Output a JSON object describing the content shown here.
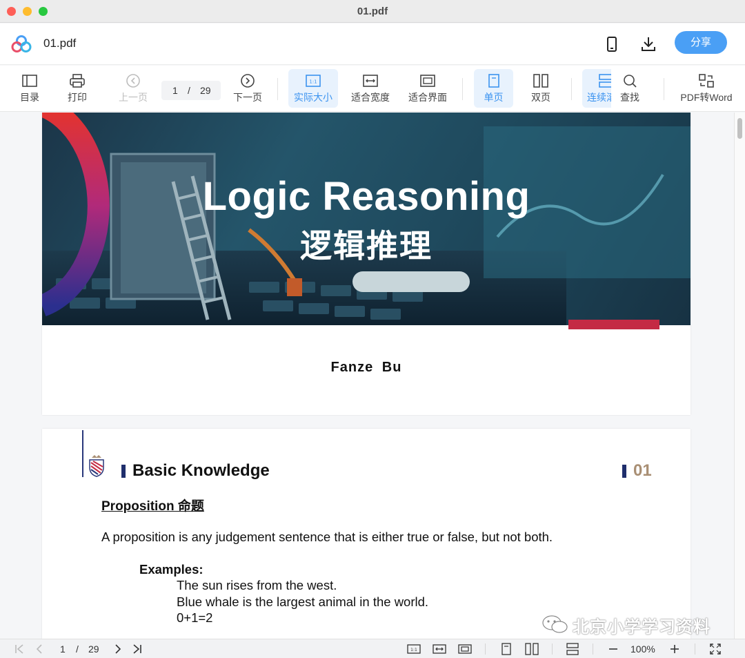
{
  "window": {
    "title": "01.pdf"
  },
  "header": {
    "filename": "01.pdf",
    "share_label": "分享",
    "accent": "#4a9ff5"
  },
  "toolbar": {
    "toc": "目录",
    "print": "打印",
    "prev": "上一页",
    "page_current": "1",
    "page_sep": "/",
    "page_total": "29",
    "next": "下一页",
    "actual_size": "实际大小",
    "fit_width": "适合宽度",
    "fit_page": "适合界面",
    "single_page": "单页",
    "double_page": "双页",
    "continuous": "连续滚",
    "find": "查找",
    "pdf_to_word": "PDF转Word"
  },
  "document": {
    "page1": {
      "title_en": "Logic Reasoning",
      "title_cn": "逻辑推理",
      "author": "Fanze Bu"
    },
    "page2": {
      "heading": "Basic Knowledge",
      "section_number": "01",
      "subheading": "Proposition 命题",
      "definition": "A proposition is any judgement sentence that is either true or false, but not both.",
      "examples_label": "Examples:",
      "examples": [
        "The sun rises from the west.",
        "Blue whale is the largest animal in the world.",
        "0+1=2"
      ]
    }
  },
  "watermark": {
    "text": "北京小学学习资料"
  },
  "statusbar": {
    "page_current": "1",
    "page_sep": "/",
    "page_total": "29",
    "zoom": "100%"
  }
}
